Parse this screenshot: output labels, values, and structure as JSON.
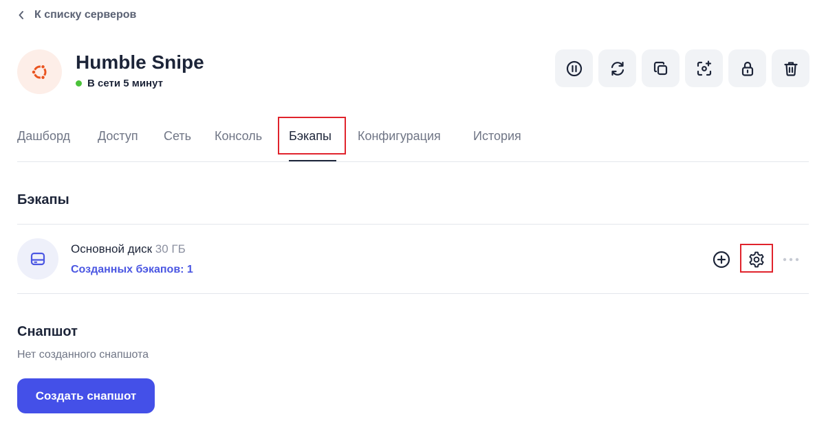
{
  "nav": {
    "back_label": "К списку серверов"
  },
  "server": {
    "name": "Humble Snipe",
    "status": "В сети 5 минут",
    "os_icon": "ubuntu-icon",
    "status_color": "#4bc23a"
  },
  "actions": [
    {
      "icon": "pause-icon"
    },
    {
      "icon": "restart-icon"
    },
    {
      "icon": "copy-icon"
    },
    {
      "icon": "screenshot-icon"
    },
    {
      "icon": "lock-icon"
    },
    {
      "icon": "trash-icon"
    }
  ],
  "tabs": [
    {
      "label": "Дашборд",
      "active": false
    },
    {
      "label": "Доступ",
      "active": false
    },
    {
      "label": "Сеть",
      "active": false
    },
    {
      "label": "Консоль",
      "active": false
    },
    {
      "label": "Бэкапы",
      "active": true
    },
    {
      "label": "Конфигурация",
      "active": false
    },
    {
      "label": "История",
      "active": false
    }
  ],
  "backups": {
    "title": "Бэкапы",
    "disk": {
      "name": "Основной диск",
      "size": "30 ГБ",
      "backups_count": "Созданных бэкапов: 1",
      "icon": "drive-icon"
    }
  },
  "snapshot": {
    "title": "Снапшот",
    "empty_text": "Нет созданного снапшота",
    "create_label": "Создать снапшот"
  },
  "colors": {
    "primary": "#4450e8",
    "link": "#4a56e2",
    "highlight": "#e0222b",
    "ubuntu": "#e95420"
  }
}
